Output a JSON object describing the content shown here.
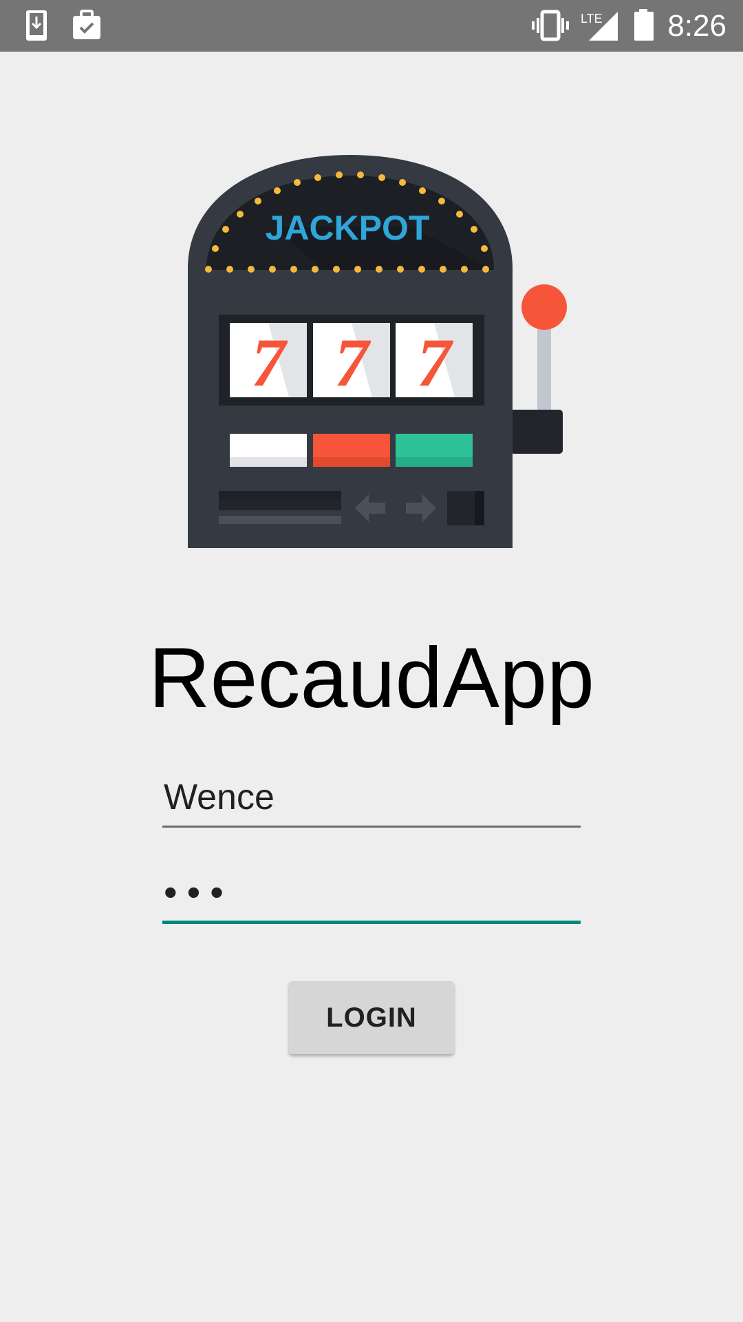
{
  "status_bar": {
    "time": "8:26",
    "network": "LTE",
    "icons": [
      "download-icon",
      "clipboard-check-icon",
      "vibrate-icon",
      "signal-icon",
      "battery-icon"
    ]
  },
  "logo": {
    "text": "JACKPOT",
    "reels": [
      "7",
      "7",
      "7"
    ]
  },
  "app": {
    "title": "RecaudApp"
  },
  "form": {
    "username_value": "Wence",
    "password_value": "•••",
    "login_label": "LOGIN"
  },
  "colors": {
    "status_bar": "#757575",
    "background": "#eeeeee",
    "accent": "#00897b",
    "button": "#d6d6d6"
  }
}
